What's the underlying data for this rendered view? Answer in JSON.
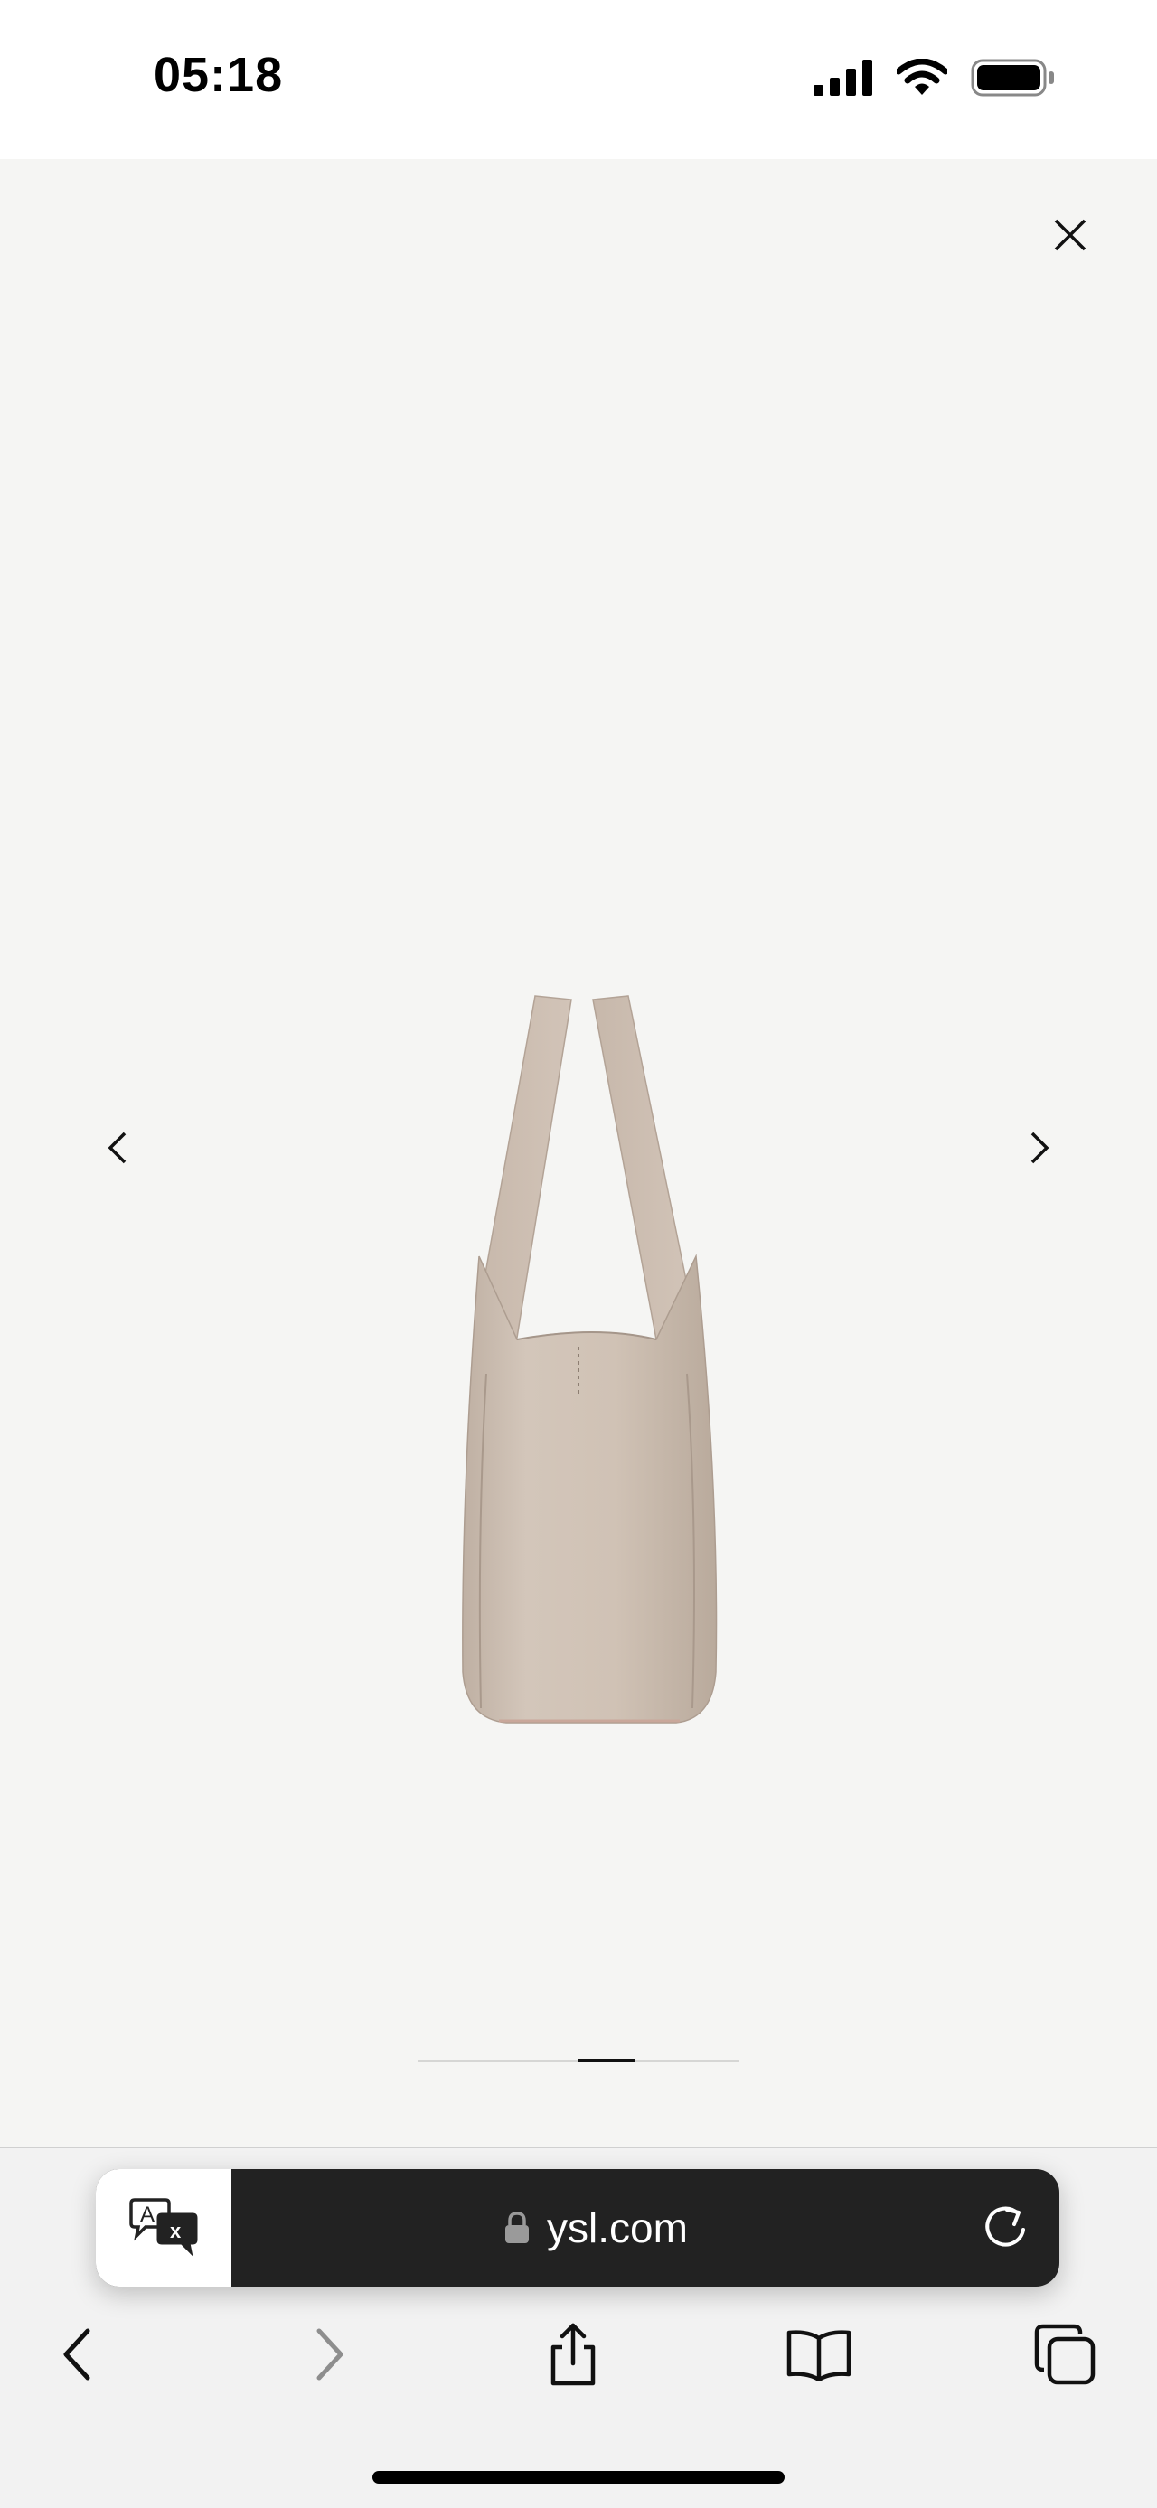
{
  "status_bar": {
    "time": "05:18",
    "icons": [
      "cellular-signal-icon",
      "wifi-icon",
      "battery-icon"
    ]
  },
  "viewer": {
    "close_icon": "close-icon",
    "prev_icon": "chevron-left-icon",
    "next_icon": "chevron-right-icon",
    "product_image": "beige leather tote bag side view",
    "pager": {
      "current_index": 2,
      "total": 4
    }
  },
  "browser": {
    "translate_icon": "translate-icon",
    "lock_icon": "lock-icon",
    "url": "ysl.com",
    "reload_icon": "reload-icon",
    "toolbar": [
      "back-icon",
      "forward-icon",
      "share-icon",
      "bookmarks-icon",
      "tabs-icon"
    ]
  },
  "colors": {
    "viewer_background": "#f5f5f3",
    "url_bar_background": "#222222",
    "bag_color": "#cdbfb3"
  }
}
